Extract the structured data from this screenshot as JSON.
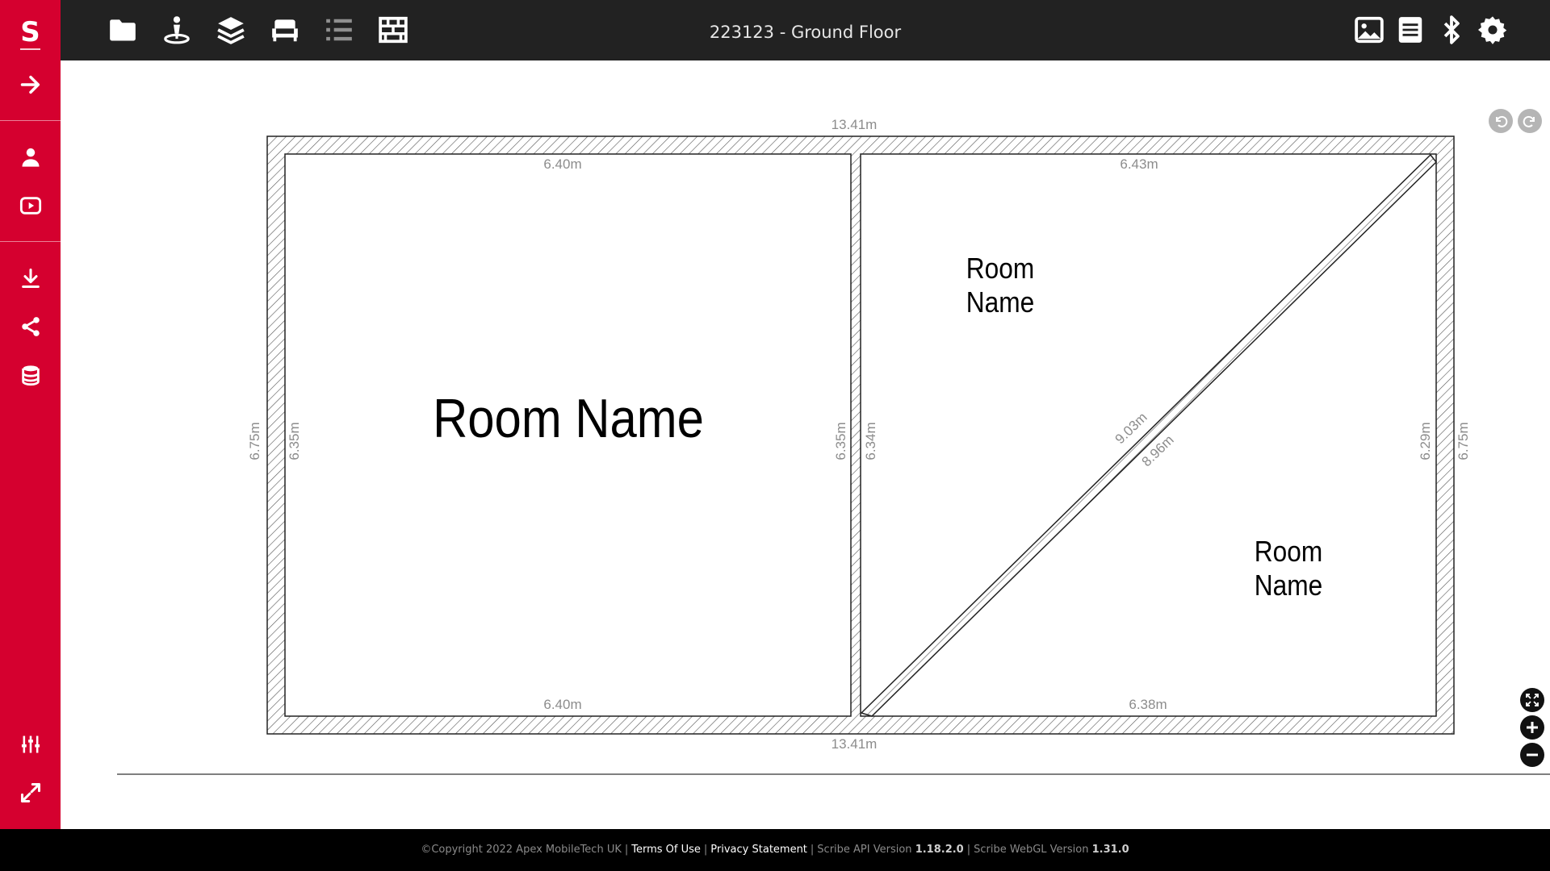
{
  "app": {
    "logo_letter": "S",
    "document_title": "223123  - Ground Floor"
  },
  "sidebar": {
    "items": [
      {
        "name": "expand-arrow-button",
        "icon": "arrow-right-icon"
      },
      {
        "name": "user-button",
        "icon": "user-icon"
      },
      {
        "name": "video-button",
        "icon": "play-video-icon"
      },
      {
        "name": "download-button",
        "icon": "download-icon"
      },
      {
        "name": "share-button",
        "icon": "share-icon"
      },
      {
        "name": "database-button",
        "icon": "database-icon"
      },
      {
        "name": "adjust-settings-button",
        "icon": "sliders-icon"
      },
      {
        "name": "fullscreen-button",
        "icon": "fullscreen-arrows-icon"
      }
    ]
  },
  "toolbar": {
    "left_icons": [
      "folder-icon",
      "person-pin-icon",
      "layers-icon",
      "furniture-icon",
      "list-icon",
      "wall-brick-icon"
    ],
    "right_icons": [
      "image-icon",
      "notes-icon",
      "bluetooth-icon",
      "gear-icon"
    ]
  },
  "floorplan": {
    "outer": {
      "top": "13.41m",
      "bottom": "13.41m",
      "left": "6.75m",
      "right": "6.75m"
    },
    "room1": {
      "name": "Room Name",
      "top": "6.40m",
      "bottom": "6.40m",
      "left": "6.35m",
      "right": "6.35m"
    },
    "room2": {
      "top": "6.43m",
      "bottom": "6.38m",
      "left": "6.34m",
      "right": "6.29m"
    },
    "diagonal": {
      "upper": "9.03m",
      "lower": "8.96m"
    },
    "room2a_name": [
      "Room",
      "Name"
    ],
    "room2b_name": [
      "Room",
      "Name"
    ]
  },
  "controls": {
    "undo_icon": "undo-icon",
    "redo_icon": "redo-icon",
    "fit_icon": "fit-to-screen-icon",
    "zoom_in_icon": "zoom-in-icon",
    "zoom_out_icon": "zoom-out-icon"
  },
  "footer": {
    "copyright": "©Copyright 2022 Apex MobileTech UK",
    "terms": "Terms Of Use",
    "privacy": "Privacy Statement",
    "api_label": "Scribe API Version",
    "api_version": "1.18.2.0",
    "webgl_label": "Scribe WebGL Version",
    "webgl_version": "1.31.0",
    "separator": "|"
  },
  "colors": {
    "brand_red": "#d5002f",
    "topbar": "#222222",
    "footer": "#000000",
    "dim_text": "#8c8c8c"
  }
}
